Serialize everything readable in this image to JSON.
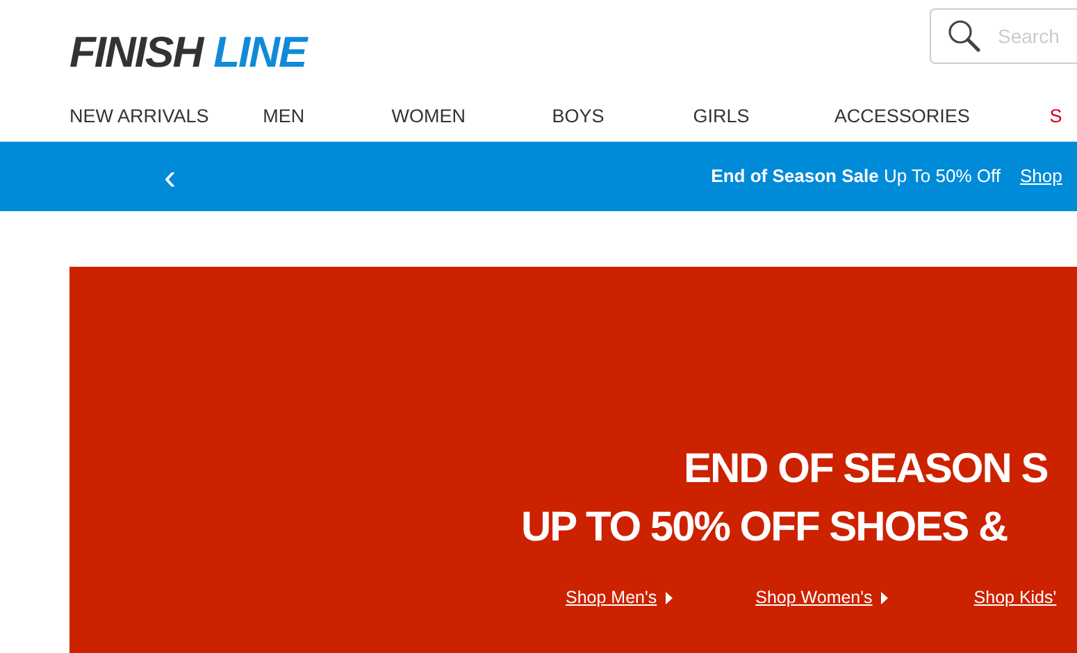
{
  "logo": {
    "part_1": "FINISH",
    "part_2": "LINE"
  },
  "search": {
    "placeholder": "Search"
  },
  "nav": [
    {
      "label": "NEW ARRIVALS",
      "color": "#333333"
    },
    {
      "label": "MEN",
      "color": "#333333"
    },
    {
      "label": "WOMEN",
      "color": "#333333"
    },
    {
      "label": "BOYS",
      "color": "#333333"
    },
    {
      "label": "GIRLS",
      "color": "#333333"
    },
    {
      "label": "ACCESSORIES",
      "color": "#333333"
    },
    {
      "label": "S",
      "color": "#d0021b"
    }
  ],
  "promo_bar": {
    "prev": "‹",
    "message": "**End of Season Sale** Up To 50% Off",
    "link": "Shop"
  },
  "hero": {
    "headline": [
      "END OF SEASON S",
      "UP TO 50% OFF SHOES &"
    ],
    "links": [
      {
        "label": "Shop Men's",
        "arrow": true
      },
      {
        "label": "Shop Women's",
        "arrow": true
      },
      {
        "label": "Shop Kids'"
      }
    ]
  }
}
